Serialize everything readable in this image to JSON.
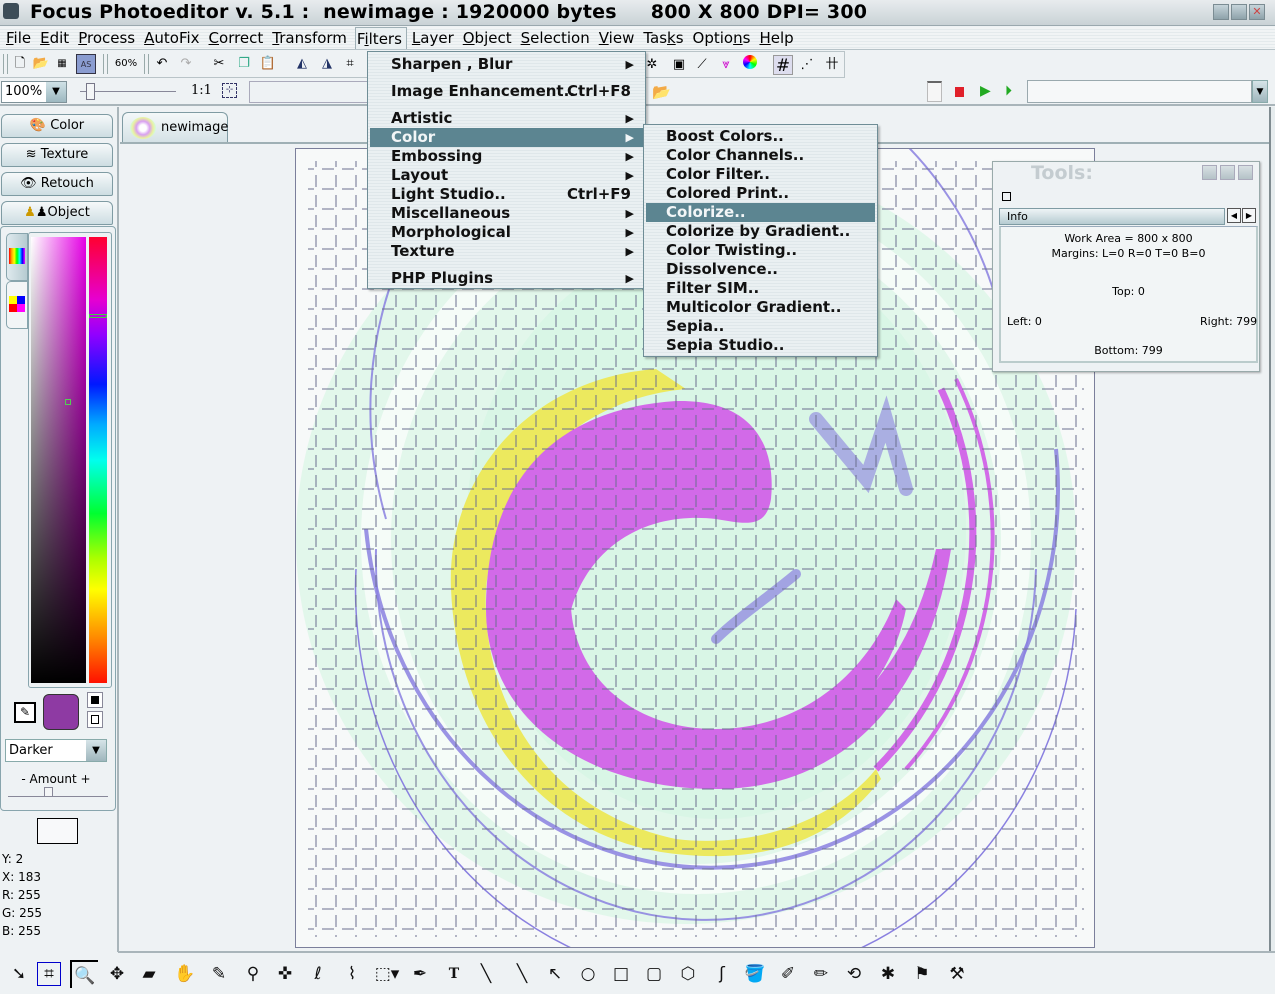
{
  "window": {
    "title": "Focus Photoeditor v. 5.1 :  newimage : 1920000 bytes     800 X 800 DPI= 300",
    "buttons": [
      "minimize",
      "maximize",
      "close"
    ]
  },
  "menubar": {
    "items": [
      {
        "label": "File",
        "key": "F"
      },
      {
        "label": "Edit",
        "key": "E"
      },
      {
        "label": "Process",
        "key": "P"
      },
      {
        "label": "AutoFix",
        "key": "A"
      },
      {
        "label": "Correct",
        "key": "C"
      },
      {
        "label": "Transform",
        "key": "T"
      },
      {
        "label": "Filters",
        "key": "i"
      },
      {
        "label": "Layer",
        "key": "L"
      },
      {
        "label": "Object",
        "key": "O"
      },
      {
        "label": "Selection",
        "key": "S"
      },
      {
        "label": "View",
        "key": "V"
      },
      {
        "label": "Tasks",
        "key": "k"
      },
      {
        "label": "Options",
        "key": "n"
      },
      {
        "label": "Help",
        "key": "H"
      }
    ],
    "open_menu": "Filters"
  },
  "toolbar1": {
    "icons": [
      "new-file-icon",
      "open-folder-icon",
      "scan-icon",
      "save-as-icon",
      "zoom-60-icon",
      "undo-icon",
      "redo-icon",
      "cut-icon",
      "copy-icon",
      "paste-icon",
      "flip-horizontal-icon",
      "flip-vertical-icon",
      "crop-icon"
    ],
    "zoom_preset": "60%"
  },
  "toolbar1b": {
    "icons": [
      "effects-icon",
      "histogram-icon",
      "curves-icon",
      "color-levels-icon",
      "color-wheel-icon",
      "grid-icon",
      "guides-icon",
      "grid-settings-icon"
    ]
  },
  "toolbar2": {
    "zoom_value": "100%",
    "ratio_label": "1:1",
    "macro_field_value": ""
  },
  "left_panel": {
    "tabs": [
      {
        "label": "Color",
        "icon": "palette-icon"
      },
      {
        "label": "Texture",
        "icon": "texture-icon"
      },
      {
        "label": "Retouch",
        "icon": "eye-icon"
      },
      {
        "label": "Object",
        "icon": "people-icon"
      }
    ],
    "current_color": "#8e3aa3",
    "mode": "Darker",
    "amount_label": "- Amount +",
    "amount_value": 0.4,
    "coords": [
      {
        "label": "Y:",
        "value": "2"
      },
      {
        "label": "X:",
        "value": "183"
      },
      {
        "label": "R:",
        "value": "255"
      },
      {
        "label": "G:",
        "value": "255"
      },
      {
        "label": "B:",
        "value": "255"
      }
    ]
  },
  "document_tab": {
    "label": "newimage"
  },
  "filters_menu": {
    "items": [
      {
        "label": "Sharpen , Blur",
        "submenu": true
      },
      {
        "label": "Image Enhancement..",
        "shortcut": "Ctrl+F8"
      },
      {
        "label": "Artistic",
        "submenu": true
      },
      {
        "label": "Color",
        "submenu": true,
        "selected": true
      },
      {
        "label": "Embossing",
        "submenu": true
      },
      {
        "label": "Layout",
        "submenu": true
      },
      {
        "label": "Light Studio..",
        "shortcut": "Ctrl+F9"
      },
      {
        "label": "Miscellaneous",
        "submenu": true
      },
      {
        "label": "Morphological",
        "submenu": true
      },
      {
        "label": "Texture",
        "submenu": true
      },
      {
        "label": "PHP Plugins",
        "submenu": true
      }
    ],
    "submenu_arrow": "▶"
  },
  "color_submenu": {
    "items": [
      {
        "label": "Boost Colors.."
      },
      {
        "label": "Color Channels.."
      },
      {
        "label": "Color Filter.."
      },
      {
        "label": "Colored Print.."
      },
      {
        "label": "Colorize..",
        "selected": true
      },
      {
        "label": "Colorize by Gradient.."
      },
      {
        "label": "Color Twisting.."
      },
      {
        "label": "Dissolvence.."
      },
      {
        "label": "Filter SIM.."
      },
      {
        "label": "Multicolor Gradient.."
      },
      {
        "label": "Sepia.."
      },
      {
        "label": "Sepia Studio.."
      }
    ]
  },
  "tools_window": {
    "title": "Tools:",
    "tab": "Info",
    "work_area": "Work Area = 800 x 800",
    "margins": "Margins: L=0 R=0 T=0 B=0",
    "top": "Top: 0",
    "left": "Left: 0",
    "right": "Right: 799",
    "bottom": "Bottom: 799"
  },
  "bottom_toolbar": {
    "tools": [
      {
        "name": "pointer-tool",
        "glyph": "➘"
      },
      {
        "name": "crop-tool",
        "glyph": "⌗"
      },
      {
        "name": "zoom-tool",
        "glyph": "🔍",
        "active": true
      },
      {
        "name": "move-tool",
        "glyph": "✥"
      },
      {
        "name": "eraser-tool",
        "glyph": "▰"
      },
      {
        "name": "hand-select-tool",
        "glyph": "✋"
      },
      {
        "name": "color-select-tool",
        "glyph": "✎"
      },
      {
        "name": "magic-wand-tool",
        "glyph": "⚲"
      },
      {
        "name": "clone-tool",
        "glyph": "✜"
      },
      {
        "name": "lasso-tool",
        "glyph": "ℓ"
      },
      {
        "name": "polygon-lasso-tool",
        "glyph": "⌇"
      },
      {
        "name": "rect-select-tool",
        "glyph": "⬚▾"
      },
      {
        "name": "eyedropper-tool",
        "glyph": "✒"
      },
      {
        "name": "text-tool",
        "glyph": "T"
      },
      {
        "name": "brush-tool",
        "glyph": "╲"
      },
      {
        "name": "line-tool",
        "glyph": "╲"
      },
      {
        "name": "arrow-tool",
        "glyph": "↖"
      },
      {
        "name": "ellipse-tool",
        "glyph": "○"
      },
      {
        "name": "rectangle-tool",
        "glyph": "□"
      },
      {
        "name": "rounded-rect-tool",
        "glyph": "▢"
      },
      {
        "name": "polygon-tool",
        "glyph": "⬡"
      },
      {
        "name": "curve-tool",
        "glyph": "ʃ"
      },
      {
        "name": "fill-tool",
        "glyph": "🪣"
      },
      {
        "name": "color-replace-tool",
        "glyph": "✐"
      },
      {
        "name": "gradient-brush-tool",
        "glyph": "✏"
      },
      {
        "name": "rotate-object-tool",
        "glyph": "⟲"
      },
      {
        "name": "effects-tool",
        "glyph": "✱"
      },
      {
        "name": "stamp-tool",
        "glyph": "⚑"
      },
      {
        "name": "tools-settings-tool",
        "glyph": "⚒"
      }
    ]
  },
  "canvas": {
    "colors": {
      "background": "#f7f9f9",
      "mint": "#d9f6e6",
      "yellow": "#ece95e",
      "magenta": "#d26ae8",
      "violet": "#8a80e0",
      "grid": "#6b6f8f"
    }
  }
}
